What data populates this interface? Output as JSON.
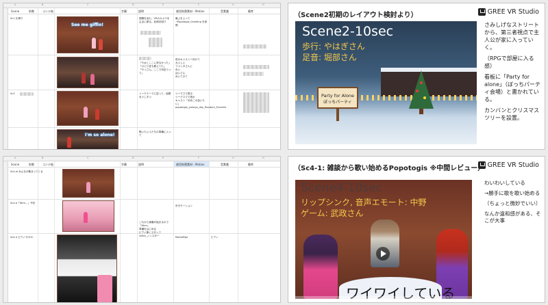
{
  "sheet1": {
    "col_letters": [
      "A",
      "B",
      "C",
      "D",
      "E",
      "F",
      "G",
      "H"
    ],
    "headers": [
      "Scene",
      "秒数",
      "コンテ絵",
      "字幕",
      "説明",
      "使用吹替素材・Motion",
      "音素番",
      "備考"
    ],
    "rows": [
      {
        "scene": "Sc1 お帰り",
        "subtitle_overlay": "See me giffin!",
        "desc": "視聴を含む、VRのカメラを主点に移る。反時計回り",
        "motion_link": "→Popotogis_Idle 吹き替え",
        "motion": "最上を上って\n→Popotogis_Greeting を参照"
      },
      {
        "scene": "",
        "desc": "「やぁとここに来なかった」\n「ひとり言も教えてた」\n「やっさん、ここで何言うって」",
        "motion": "前のキャストへ向けて\n大人しい\nファンタさんと\n歩い\nぽいさん\n歩いてきて"
      },
      {
        "scene": "Sc3",
        "desc": "トークテーマに従って、話題を少しずつ",
        "motion": "ツーデスマ表示\nツーデスマで表示\nキャスト「ああこの会いたい」 popotogis_yaheyp_day_Random_Fennetir"
      },
      {
        "scene": "",
        "subtitle_overlay": "I'm so alone!",
        "desc": "歌いたい人たちの準備に入って"
      }
    ]
  },
  "sheet2": {
    "col_letters": [
      "A",
      "B",
      "C",
      "D",
      "E",
      "F",
      "G",
      "H"
    ],
    "headers": [
      "Scene",
      "秒数",
      "コンテ絵",
      "字幕",
      "説明",
      "使用吹替素材・Motion",
      "音素番",
      "備考"
    ],
    "rows": [
      {
        "scene": "Sc4-ai みんなが集まってくる",
        "desc": "",
        "motion": ""
      },
      {
        "scene": "Sc4-b「Wrm…」不在",
        "desc": "これから演奏が始まるので\n「Wrm」\n準備をはじめる\nピアノ弾くスタッフ\nvideo_ノンスター",
        "motion": "歩きモーション"
      },
      {
        "scene": "Sc4-4 ピアノでOOC",
        "desc": "",
        "motion": "MediaPipe",
        "sound": "ピアノ"
      }
    ]
  },
  "slide1": {
    "title": "（Scene2初期のレイアウト検討より）",
    "brand": "GREE VR Studio",
    "hero_title": "Scene2-10sec",
    "hero_line1": "歩行: やはぎさん",
    "hero_line2": "足音: 堀部さん",
    "sign_line1": "Party for Alone",
    "sign_line2": "ぼっちパーティ",
    "notes": [
      "さみしげなストリートから、第三者視点で主人公が家に入っていく。",
      "（RPGで部屋に入る感）",
      "看板に「Party for alone」（ぼっちパーティ会場）と書かれている。",
      "カンバンとクリスマスツリーを設置。"
    ]
  },
  "slide2": {
    "title": "（Sc4-1: 雑談から歌い始めるPopotogis ※中間レビュー）",
    "brand": "GREE VR Studio",
    "hero_title": "Scene4-10sec",
    "hero_line1": "リップシンク, 音声エモート: 中野",
    "hero_line2": "ゲーム: 武政さん",
    "caption": "ワイワイしている",
    "notes": [
      "わいわいしている",
      "→勝手に歌を歌い始める",
      "（ちょっと微妙でいい）",
      "なんか違和感がある、そこが大事"
    ]
  }
}
